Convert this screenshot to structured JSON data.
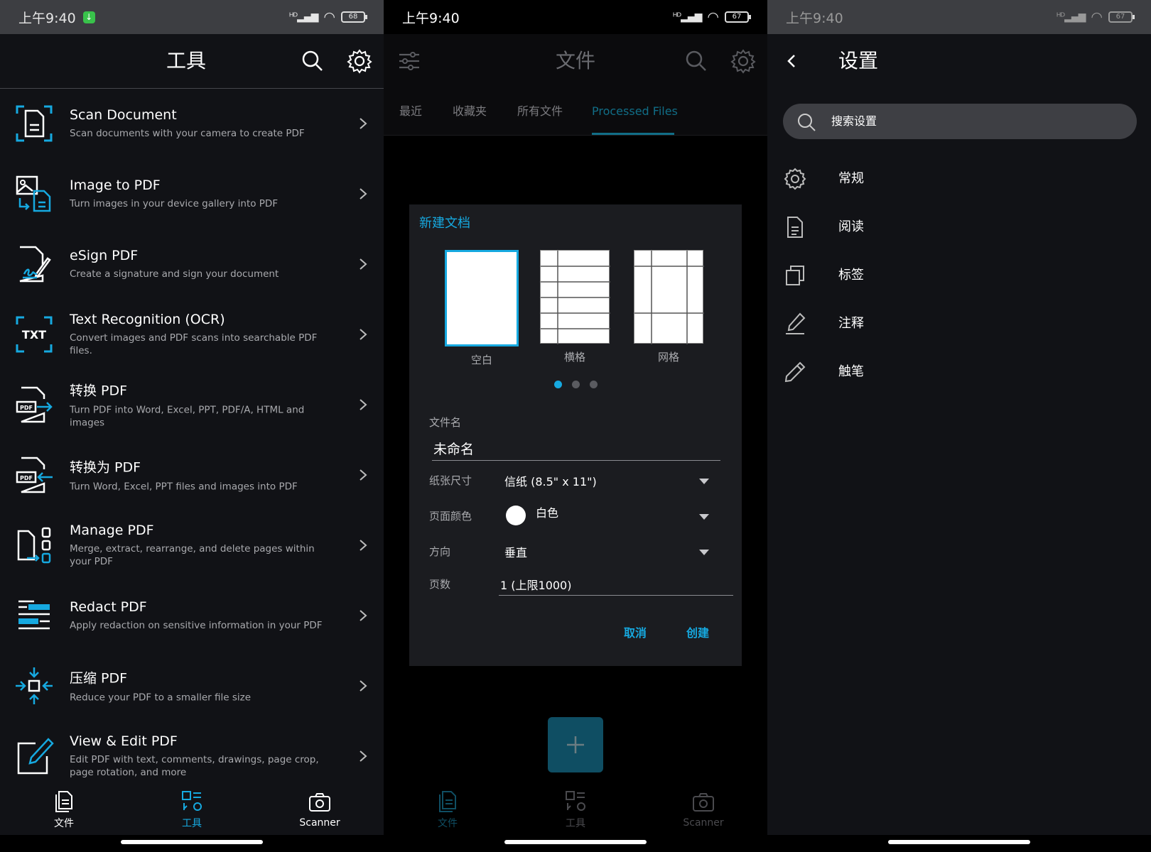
{
  "colors": {
    "accent": "#16a9e0",
    "bg_dark": "#111216",
    "fab": "#0f4e63",
    "statusbar": "#3d3e42"
  },
  "tools_screen": {
    "status": {
      "time": "上午9:40",
      "battery": "68"
    },
    "title": "工具",
    "items": [
      {
        "icon": "scan-document-icon",
        "title": "Scan Document",
        "subtitle": "Scan documents with your camera to create PDF"
      },
      {
        "icon": "image-to-pdf-icon",
        "title": "Image to PDF",
        "subtitle": "Turn images in your device gallery into PDF"
      },
      {
        "icon": "esign-icon",
        "title": "eSign PDF",
        "subtitle": "Create a signature and sign your document"
      },
      {
        "icon": "ocr-txt-icon",
        "title": "Text Recognition (OCR)",
        "subtitle": "Convert images and PDF scans into searchable PDF files."
      },
      {
        "icon": "convert-pdf-icon",
        "title": "转换 PDF",
        "subtitle": "Turn PDF into Word, Excel, PPT, PDF/A, HTML and images"
      },
      {
        "icon": "convert-to-pdf-icon",
        "title": "转换为 PDF",
        "subtitle": "Turn Word, Excel, PPT files and images into PDF"
      },
      {
        "icon": "manage-pdf-icon",
        "title": "Manage PDF",
        "subtitle": "Merge, extract, rearrange, and delete pages within your PDF"
      },
      {
        "icon": "redact-icon",
        "title": "Redact PDF",
        "subtitle": "Apply redaction on sensitive information in your PDF"
      },
      {
        "icon": "compress-icon",
        "title": "压缩 PDF",
        "subtitle": "Reduce your PDF to a smaller file size"
      },
      {
        "icon": "edit-pdf-icon",
        "title": "View & Edit PDF",
        "subtitle": "Edit PDF with text, comments, drawings, page crop, page rotation, and more"
      }
    ],
    "nav": {
      "files": "文件",
      "tools": "工具",
      "scanner": "Scanner"
    }
  },
  "files_screen": {
    "status": {
      "time": "上午9:40",
      "battery": "67"
    },
    "title": "文件",
    "tabs": [
      "最近",
      "收藏夹",
      "所有文件",
      "Processed Files"
    ],
    "dialog": {
      "title": "新建文档",
      "templates": [
        "空白",
        "横格",
        "网格"
      ],
      "filename_label": "文件名",
      "filename_value": "未命名",
      "paper_size_label": "纸张尺寸",
      "paper_size_value": "信纸 (8.5\" x 11\")",
      "page_color_label": "页面颜色",
      "page_color_value": "白色",
      "orientation_label": "方向",
      "orientation_value": "垂直",
      "pages_label": "页数",
      "pages_value": "1 (上限1000)",
      "cancel": "取消",
      "create": "创建"
    },
    "nav": {
      "files": "文件",
      "tools": "工具",
      "scanner": "Scanner"
    }
  },
  "settings_screen": {
    "status": {
      "time": "上午9:40",
      "battery": "67"
    },
    "title": "设置",
    "search_placeholder": "搜索设置",
    "items": [
      {
        "icon": "gear-icon",
        "label": "常规"
      },
      {
        "icon": "document-icon",
        "label": "阅读"
      },
      {
        "icon": "tabs-icon",
        "label": "标签"
      },
      {
        "icon": "annotate-pen-icon",
        "label": "注释"
      },
      {
        "icon": "stylus-icon",
        "label": "触笔"
      }
    ]
  }
}
